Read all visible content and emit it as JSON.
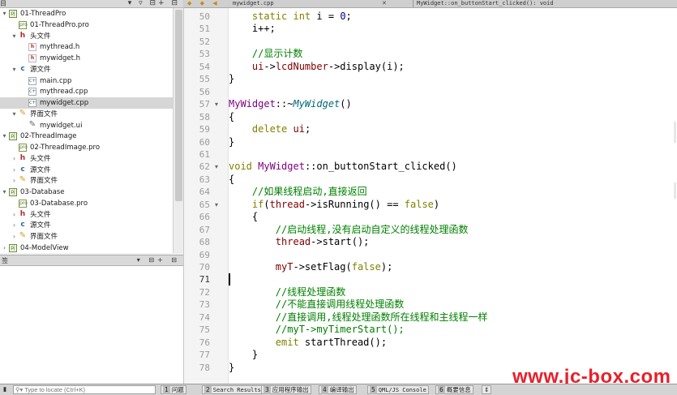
{
  "left_panel": {
    "header_icons": "▾ ▿ ⊟+ ⊟",
    "header_label": "目",
    "tree": [
      {
        "label": "01-ThreadPro",
        "icon": "project-icon",
        "depth": 0,
        "arrow": "▾"
      },
      {
        "label": "01-ThreadPro.pro",
        "icon": "pro-file-icon",
        "depth": 1,
        "arrow": ""
      },
      {
        "label": "头文件",
        "icon": "header-folder-icon",
        "depth": 1,
        "arrow": "▾"
      },
      {
        "label": "mythread.h",
        "icon": "h-file-icon",
        "depth": 2,
        "arrow": ""
      },
      {
        "label": "mywidget.h",
        "icon": "h-file-icon",
        "depth": 2,
        "arrow": ""
      },
      {
        "label": "源文件",
        "icon": "source-folder-icon",
        "depth": 1,
        "arrow": "▾"
      },
      {
        "label": "main.cpp",
        "icon": "cpp-file-icon",
        "depth": 2,
        "arrow": ""
      },
      {
        "label": "mythread.cpp",
        "icon": "cpp-file-icon",
        "depth": 2,
        "arrow": ""
      },
      {
        "label": "mywidget.cpp",
        "icon": "cpp-file-icon",
        "depth": 2,
        "arrow": "",
        "selected": true
      },
      {
        "label": "界面文件",
        "icon": "forms-folder-icon",
        "depth": 1,
        "arrow": "▾"
      },
      {
        "label": "mywidget.ui",
        "icon": "ui-file-icon",
        "depth": 2,
        "arrow": ""
      },
      {
        "label": "02-ThreadImage",
        "icon": "project-icon",
        "depth": 0,
        "arrow": "▾"
      },
      {
        "label": "02-ThreadImage.pro",
        "icon": "pro-file-icon",
        "depth": 1,
        "arrow": ""
      },
      {
        "label": "头文件",
        "icon": "header-folder-icon",
        "depth": 1,
        "arrow": "›"
      },
      {
        "label": "源文件",
        "icon": "source-folder-icon",
        "depth": 1,
        "arrow": "›"
      },
      {
        "label": "界面文件",
        "icon": "forms-folder-icon",
        "depth": 1,
        "arrow": "›"
      },
      {
        "label": "03-Database",
        "icon": "project-icon",
        "depth": 0,
        "arrow": "▾"
      },
      {
        "label": "03-Database.pro",
        "icon": "pro-file-icon",
        "depth": 1,
        "arrow": ""
      },
      {
        "label": "头文件",
        "icon": "header-folder-icon",
        "depth": 1,
        "arrow": "›"
      },
      {
        "label": "源文件",
        "icon": "source-folder-icon",
        "depth": 1,
        "arrow": "›"
      },
      {
        "label": "界面文件",
        "icon": "forms-folder-icon",
        "depth": 1,
        "arrow": "›"
      },
      {
        "label": "04-ModelView",
        "icon": "project-icon",
        "depth": 0,
        "arrow": "›"
      }
    ],
    "bottom_panel_title": "签",
    "bottom_panel_icons": "▾ ⊟+ ⊟"
  },
  "editor": {
    "nav_icons": "◆ ◆ ◀",
    "file_name": "mywidget.cpp",
    "close_label": "✕",
    "function_name": "MyWidget::on_buttonStart_clicked(): void",
    "current_line": 71,
    "lines": [
      {
        "n": 50,
        "fold": "",
        "tokens": [
          [
            "    ",
            ""
          ],
          [
            "static",
            "kw"
          ],
          [
            " ",
            ""
          ],
          [
            "int",
            "ty"
          ],
          [
            " i = ",
            ""
          ],
          [
            "0",
            "num"
          ],
          [
            ";",
            ""
          ]
        ]
      },
      {
        "n": 51,
        "fold": "",
        "tokens": [
          [
            "    i++;",
            ""
          ]
        ]
      },
      {
        "n": 52,
        "fold": "",
        "tokens": []
      },
      {
        "n": 53,
        "fold": "",
        "tokens": [
          [
            "    ",
            ""
          ],
          [
            "//显示计数",
            "cmt"
          ]
        ]
      },
      {
        "n": 54,
        "fold": "",
        "tokens": [
          [
            "    ",
            ""
          ],
          [
            "ui",
            "mem"
          ],
          [
            "->",
            ""
          ],
          [
            "lcdNumber",
            "mem"
          ],
          [
            "->display(i);",
            ""
          ]
        ]
      },
      {
        "n": 55,
        "fold": "",
        "tokens": [
          [
            "}",
            ""
          ]
        ]
      },
      {
        "n": 56,
        "fold": "",
        "tokens": []
      },
      {
        "n": 57,
        "fold": "▾",
        "tokens": [
          [
            "MyWidget",
            "cls"
          ],
          [
            "::~",
            ""
          ],
          [
            "MyWidget",
            "fn"
          ],
          [
            "()",
            ""
          ]
        ]
      },
      {
        "n": 58,
        "fold": "",
        "tokens": [
          [
            "{",
            ""
          ]
        ]
      },
      {
        "n": 59,
        "fold": "",
        "tokens": [
          [
            "    ",
            ""
          ],
          [
            "delete",
            "kw"
          ],
          [
            " ",
            ""
          ],
          [
            "ui",
            "mem"
          ],
          [
            ";",
            ""
          ]
        ]
      },
      {
        "n": 60,
        "fold": "",
        "tokens": [
          [
            "}",
            ""
          ]
        ]
      },
      {
        "n": 61,
        "fold": "",
        "tokens": []
      },
      {
        "n": 62,
        "fold": "▾",
        "tokens": [
          [
            "void",
            "kw"
          ],
          [
            " ",
            ""
          ],
          [
            "MyWidget",
            "cls"
          ],
          [
            "::on_buttonStart_clicked()",
            ""
          ]
        ]
      },
      {
        "n": 63,
        "fold": "",
        "tokens": [
          [
            "{",
            ""
          ]
        ]
      },
      {
        "n": 64,
        "fold": "",
        "tokens": [
          [
            "    ",
            ""
          ],
          [
            "//如果线程启动,直接返回",
            "cmt"
          ]
        ]
      },
      {
        "n": 65,
        "fold": "▾",
        "tokens": [
          [
            "    ",
            ""
          ],
          [
            "if",
            "kw"
          ],
          [
            "(",
            ""
          ],
          [
            "thread",
            "mem"
          ],
          [
            "->isRunning() == ",
            ""
          ],
          [
            "false",
            "kw"
          ],
          [
            ")",
            ""
          ]
        ]
      },
      {
        "n": 66,
        "fold": "",
        "tokens": [
          [
            "    {",
            ""
          ]
        ]
      },
      {
        "n": 67,
        "fold": "",
        "tokens": [
          [
            "        ",
            ""
          ],
          [
            "//启动线程,没有启动自定义的线程处理函数",
            "cmt"
          ]
        ]
      },
      {
        "n": 68,
        "fold": "",
        "tokens": [
          [
            "        ",
            ""
          ],
          [
            "thread",
            "mem"
          ],
          [
            "->start();",
            ""
          ]
        ]
      },
      {
        "n": 69,
        "fold": "",
        "tokens": []
      },
      {
        "n": 70,
        "fold": "",
        "tokens": [
          [
            "        ",
            ""
          ],
          [
            "myT",
            "mem"
          ],
          [
            "->setFlag(",
            ""
          ],
          [
            "false",
            "kw"
          ],
          [
            ");",
            ""
          ]
        ]
      },
      {
        "n": 71,
        "fold": "",
        "tokens": []
      },
      {
        "n": 72,
        "fold": "",
        "tokens": [
          [
            "        ",
            ""
          ],
          [
            "//线程处理函数",
            "cmt"
          ]
        ]
      },
      {
        "n": 73,
        "fold": "",
        "tokens": [
          [
            "        ",
            ""
          ],
          [
            "//不能直接调用线程处理函数",
            "cmt"
          ]
        ]
      },
      {
        "n": 74,
        "fold": "",
        "tokens": [
          [
            "        ",
            ""
          ],
          [
            "//直接调用,线程处理函数所在线程和主线程一样",
            "cmt"
          ]
        ]
      },
      {
        "n": 75,
        "fold": "",
        "tokens": [
          [
            "        ",
            ""
          ],
          [
            "//myT->myTimerStart();",
            "cmt"
          ]
        ]
      },
      {
        "n": 76,
        "fold": "",
        "tokens": [
          [
            "        ",
            ""
          ],
          [
            "emit",
            "kw"
          ],
          [
            " startThread();",
            ""
          ]
        ]
      },
      {
        "n": 77,
        "fold": "",
        "tokens": [
          [
            "    }",
            ""
          ]
        ]
      },
      {
        "n": 78,
        "fold": "",
        "tokens": [
          [
            "}",
            ""
          ]
        ]
      }
    ]
  },
  "watermark": "www.jc-box.com",
  "status_bar": {
    "left_icon": "▮",
    "locator_placeholder": "⚲▾ Type to locate (Ctrl+K)",
    "tabs": [
      {
        "num": "1",
        "label": "问题"
      },
      {
        "num": "2",
        "label": "Search Results",
        "mono": true
      },
      {
        "num": "3",
        "label": "应用程序输出"
      },
      {
        "num": "4",
        "label": "编译输出"
      },
      {
        "num": "5",
        "label": "QML/JS Console",
        "mono": true
      },
      {
        "num": "6",
        "label": "概要信息"
      },
      {
        "num": "",
        "label": "⇕"
      }
    ]
  },
  "colors": {
    "comment": "#008000",
    "keyword": "#808000",
    "member": "#800000",
    "class": "#800080",
    "watermark": "#e8202a"
  }
}
